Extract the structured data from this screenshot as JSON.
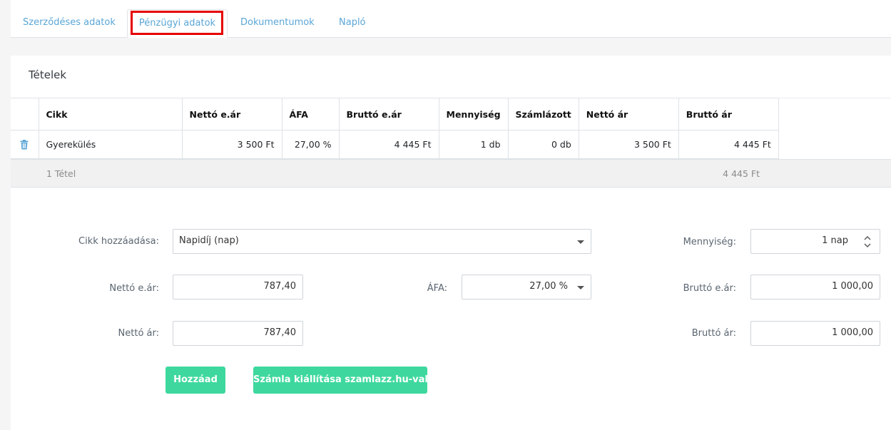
{
  "tabs": [
    {
      "label": "Szerződéses adatok"
    },
    {
      "label": "Pénzügyi adatok"
    },
    {
      "label": "Dokumentumok"
    },
    {
      "label": "Napló"
    }
  ],
  "card": {
    "title": "Tételek"
  },
  "table": {
    "headers": [
      "Cikk",
      "Nettó e.ár",
      "ÁFA",
      "Bruttó e.ár",
      "Mennyiség",
      "Számlázott",
      "Nettó ár",
      "Bruttó ár"
    ],
    "rows": [
      {
        "cikk": "Gyerekülés",
        "netto_ear": "3 500 Ft",
        "afa": "27,00 %",
        "brutto_ear": "4 445 Ft",
        "mennyiseg": "1 db",
        "szamlazott": "0 db",
        "netto_ar": "3 500 Ft",
        "brutto_ar": "4 445 Ft"
      }
    ],
    "summary": {
      "count": "1 Tétel",
      "total": "4 445 Ft"
    }
  },
  "form": {
    "cikk_label": "Cikk hozzáadása:",
    "cikk_value": "Napidíj (nap)",
    "mennyiseg_label": "Mennyiség:",
    "mennyiseg_value": "1 nap",
    "netto_ear_label": "Nettó e.ár:",
    "netto_ear_value": "787,40",
    "afa_label": "ÁFA:",
    "afa_value": "27,00 %",
    "brutto_ear_label": "Bruttó e.ár:",
    "brutto_ear_value": "1 000,00",
    "netto_ar_label": "Nettó ár:",
    "netto_ar_value": "787,40",
    "brutto_ar_label": "Bruttó ár:",
    "brutto_ar_value": "1 000,00"
  },
  "buttons": {
    "add": "Hozzáad",
    "invoice": "Számla kiállítása szamlazz.hu-val"
  },
  "colors": {
    "accent": "#3ed89e",
    "tab_link": "#5aa6d6",
    "highlight": "#e60000",
    "trash": "#5aa6d6"
  },
  "icons": {
    "trash": "trash-icon",
    "dropdown": "chevron-down-icon",
    "spinner": "up-down-spinner-icon"
  }
}
